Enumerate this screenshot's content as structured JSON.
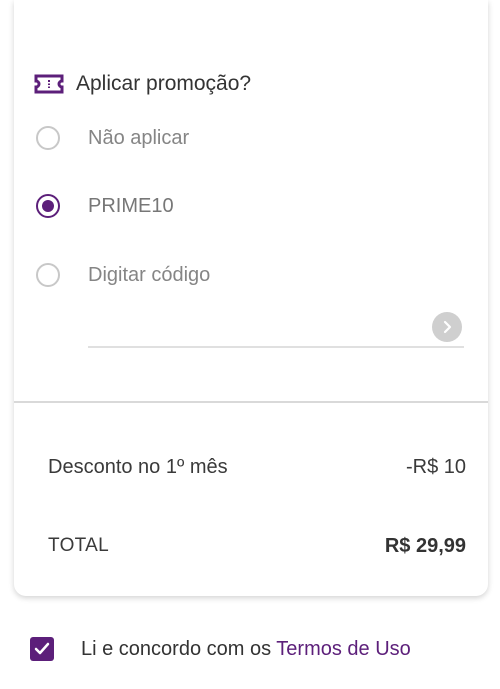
{
  "promo": {
    "title": "Aplicar promoção?",
    "options": [
      {
        "label": "Não aplicar",
        "selected": false
      },
      {
        "label": "PRIME10",
        "selected": true
      },
      {
        "label": "Digitar código",
        "selected": false
      }
    ],
    "code_input_value": "",
    "icons": {
      "header": "ticket-icon",
      "submit": "chevron-right-icon"
    }
  },
  "summary": {
    "discount_label": "Desconto no 1º mês",
    "discount_value": "-R$ 10",
    "total_label": "TOTAL",
    "total_value": "R$ 29,99"
  },
  "terms": {
    "checked": true,
    "text": "Li e concordo com os ",
    "link": "Termos de Uso"
  },
  "colors": {
    "accent": "#5c1f7a",
    "radio_border": "#c8c8c8",
    "button_disabled": "#cfcfcf"
  }
}
